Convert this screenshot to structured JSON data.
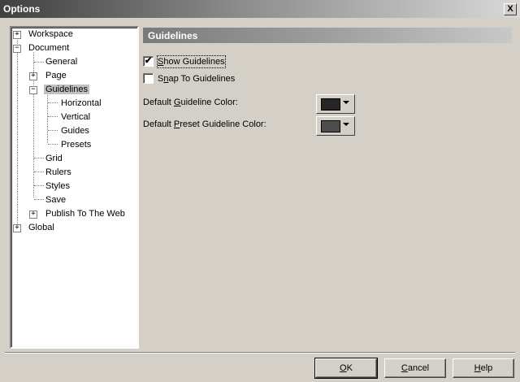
{
  "window": {
    "title": "Options",
    "close_glyph": "X"
  },
  "tree": {
    "workspace": "Workspace",
    "document": "Document",
    "general": "General",
    "page": "Page",
    "guidelines": "Guidelines",
    "horizontal": "Horizontal",
    "vertical": "Vertical",
    "guides": "Guides",
    "presets": "Presets",
    "grid": "Grid",
    "rulers": "Rulers",
    "styles": "Styles",
    "save": "Save",
    "publish": "Publish To The Web",
    "global": "Global",
    "selected": "Guidelines",
    "expanded_glyph": "−",
    "collapsed_glyph": "+"
  },
  "panel": {
    "header": "Guidelines",
    "show_guidelines": {
      "pre": "",
      "key": "S",
      "post": "how Guidelines",
      "checked": true,
      "check_glyph": "✔"
    },
    "snap_guidelines": {
      "pre": "S",
      "key": "n",
      "post": "ap To Guidelines",
      "checked": false
    },
    "guideline_color": {
      "pre": "Default ",
      "key": "G",
      "post": "uideline Color:",
      "swatch": "#262626"
    },
    "preset_color": {
      "pre": "Default ",
      "key": "P",
      "post": "reset Guideline Color:",
      "swatch": "#4d4d4d"
    }
  },
  "buttons": {
    "ok": {
      "key": "O",
      "post": "K"
    },
    "cancel": {
      "key": "C",
      "post": "ancel"
    },
    "help": {
      "key": "H",
      "post": "elp"
    }
  }
}
